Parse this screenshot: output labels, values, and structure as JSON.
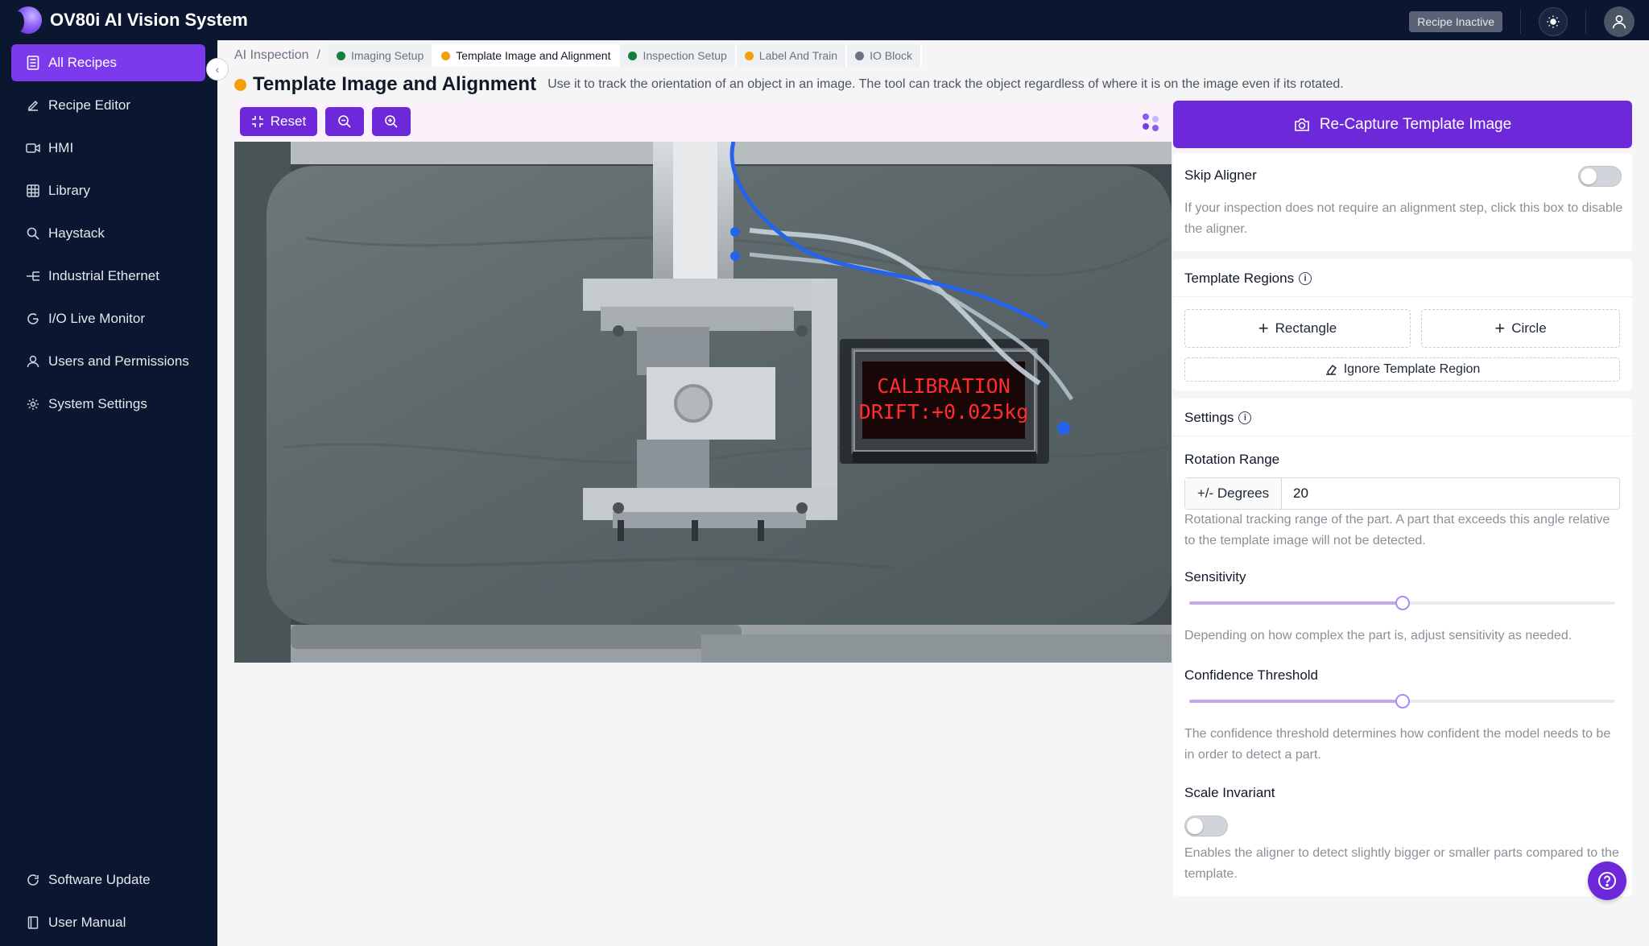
{
  "app": {
    "title": "OV80i AI Vision System"
  },
  "topbar": {
    "recipe_status": "Recipe Inactive",
    "theme_icon": "sun-icon",
    "profile_icon": "user-icon"
  },
  "sidebar": {
    "items": [
      {
        "label": "All Recipes",
        "icon": "recipes-icon",
        "active": true
      },
      {
        "label": "Recipe Editor",
        "icon": "pencil-icon"
      },
      {
        "label": "HMI",
        "icon": "video-icon"
      },
      {
        "label": "Library",
        "icon": "grid-icon"
      },
      {
        "label": "Haystack",
        "icon": "search-icon"
      },
      {
        "label": "Industrial Ethernet",
        "icon": "network-icon"
      },
      {
        "label": "I/O Live Monitor",
        "icon": "monitor-icon"
      },
      {
        "label": "Users and Permissions",
        "icon": "user-icon"
      },
      {
        "label": "System Settings",
        "icon": "gear-icon"
      }
    ],
    "bottom": [
      {
        "label": "Software Update",
        "icon": "refresh-icon"
      },
      {
        "label": "User Manual",
        "icon": "book-icon"
      }
    ]
  },
  "breadcrumb": {
    "root": "AI Inspection",
    "separator": "/",
    "steps": [
      {
        "label": "Imaging Setup",
        "color": "#15803d"
      },
      {
        "label": "Template Image and Alignment",
        "color": "#f59e0b",
        "current": true
      },
      {
        "label": "Inspection Setup",
        "color": "#15803d"
      },
      {
        "label": "Label And Train",
        "color": "#f59e0b"
      },
      {
        "label": "IO Block",
        "color": "#6b7280"
      }
    ]
  },
  "page": {
    "title": "Template Image and Alignment",
    "description": "Use it to track the orientation of an object in an image. The tool can track the object regardless of where it is on the image even if its rotated."
  },
  "viewer": {
    "reset_label": "Reset",
    "display_text_line1": "CALIBRATION",
    "display_text_line2": "DRIFT:+0.025kg"
  },
  "right_panel": {
    "recapture_label": "Re-Capture Template Image",
    "skip_aligner": {
      "label": "Skip Aligner",
      "enabled": false,
      "help": "If your inspection does not require an alignment step, click this box to disable the aligner."
    },
    "template_regions": {
      "title": "Template Regions",
      "rectangle_label": "Rectangle",
      "circle_label": "Circle",
      "ignore_label": "Ignore Template Region"
    },
    "settings": {
      "title": "Settings",
      "rotation_range": {
        "label": "Rotation Range",
        "addon": "+/- Degrees",
        "value": "20",
        "help": "Rotational tracking range of the part. A part that exceeds this angle relative to the template image will not be detected."
      },
      "sensitivity": {
        "label": "Sensitivity",
        "fraction": 0.5,
        "help": "Depending on how complex the part is, adjust sensitivity as needed."
      },
      "confidence": {
        "label": "Confidence Threshold",
        "fraction": 0.5,
        "help": "The confidence threshold determines how confident the model needs to be in order to detect a part."
      },
      "scale_invariant": {
        "label": "Scale Invariant",
        "enabled": false,
        "help": "Enables the aligner to detect slightly bigger or smaller parts compared to the template."
      }
    }
  },
  "colors": {
    "accent": "#6d28d9",
    "active_nav": "#7c3aed",
    "topbar": "#0b1730"
  }
}
